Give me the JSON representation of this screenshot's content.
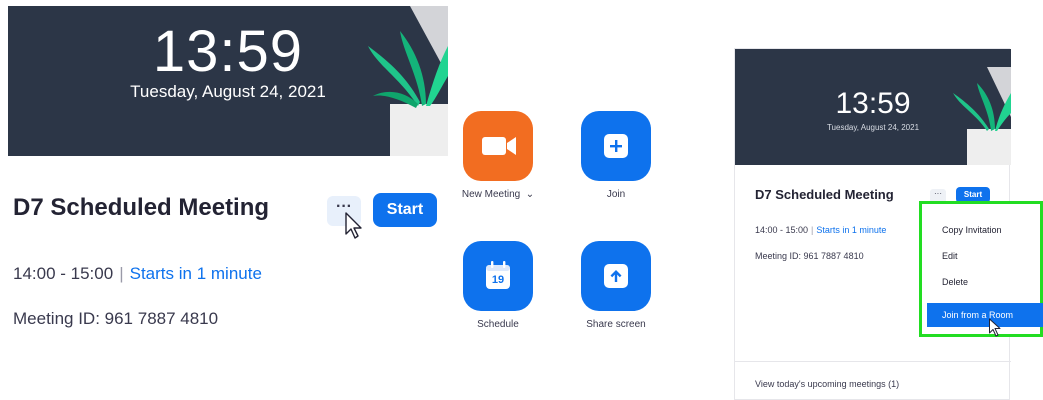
{
  "left": {
    "time": "13:59",
    "date": "Tuesday, August 24, 2021",
    "meeting_title": "D7 Scheduled Meeting",
    "more_label": "···",
    "start_label": "Start",
    "time_range": "14:00 - 15:00",
    "separator": "|",
    "starts_in": "Starts in 1 minute",
    "meeting_id": "Meeting ID: 961 7887 4810"
  },
  "actions": {
    "new_meeting": {
      "label": "New Meeting",
      "icon": "video-camera-icon",
      "color": "#f26d21"
    },
    "dropdown_glyph": "⌄",
    "join": {
      "label": "Join",
      "icon": "plus-icon",
      "color": "#0e72ed"
    },
    "schedule": {
      "label": "Schedule",
      "icon": "calendar-icon",
      "day": "19",
      "color": "#0e72ed"
    },
    "share_screen": {
      "label": "Share screen",
      "icon": "upload-arrow-icon",
      "color": "#0e72ed"
    }
  },
  "right": {
    "time": "13:59",
    "date": "Tuesday, August 24, 2021",
    "meeting_title": "D7 Scheduled Meeting",
    "more_label": "···",
    "start_label": "Start",
    "time_range": "14:00 - 15:00",
    "separator": "|",
    "starts_in": "Starts in 1 minute",
    "meeting_id": "Meeting ID: 961 7887 4810",
    "upcoming": "View today's upcoming meetings (1)",
    "menu": {
      "items": [
        "Copy Invitation",
        "Edit",
        "Delete",
        "Join from a Room"
      ],
      "highlight_color": "#22dd22"
    }
  },
  "colors": {
    "banner": "#2c3647",
    "accent": "#0e72ed",
    "orange": "#f26d21"
  }
}
